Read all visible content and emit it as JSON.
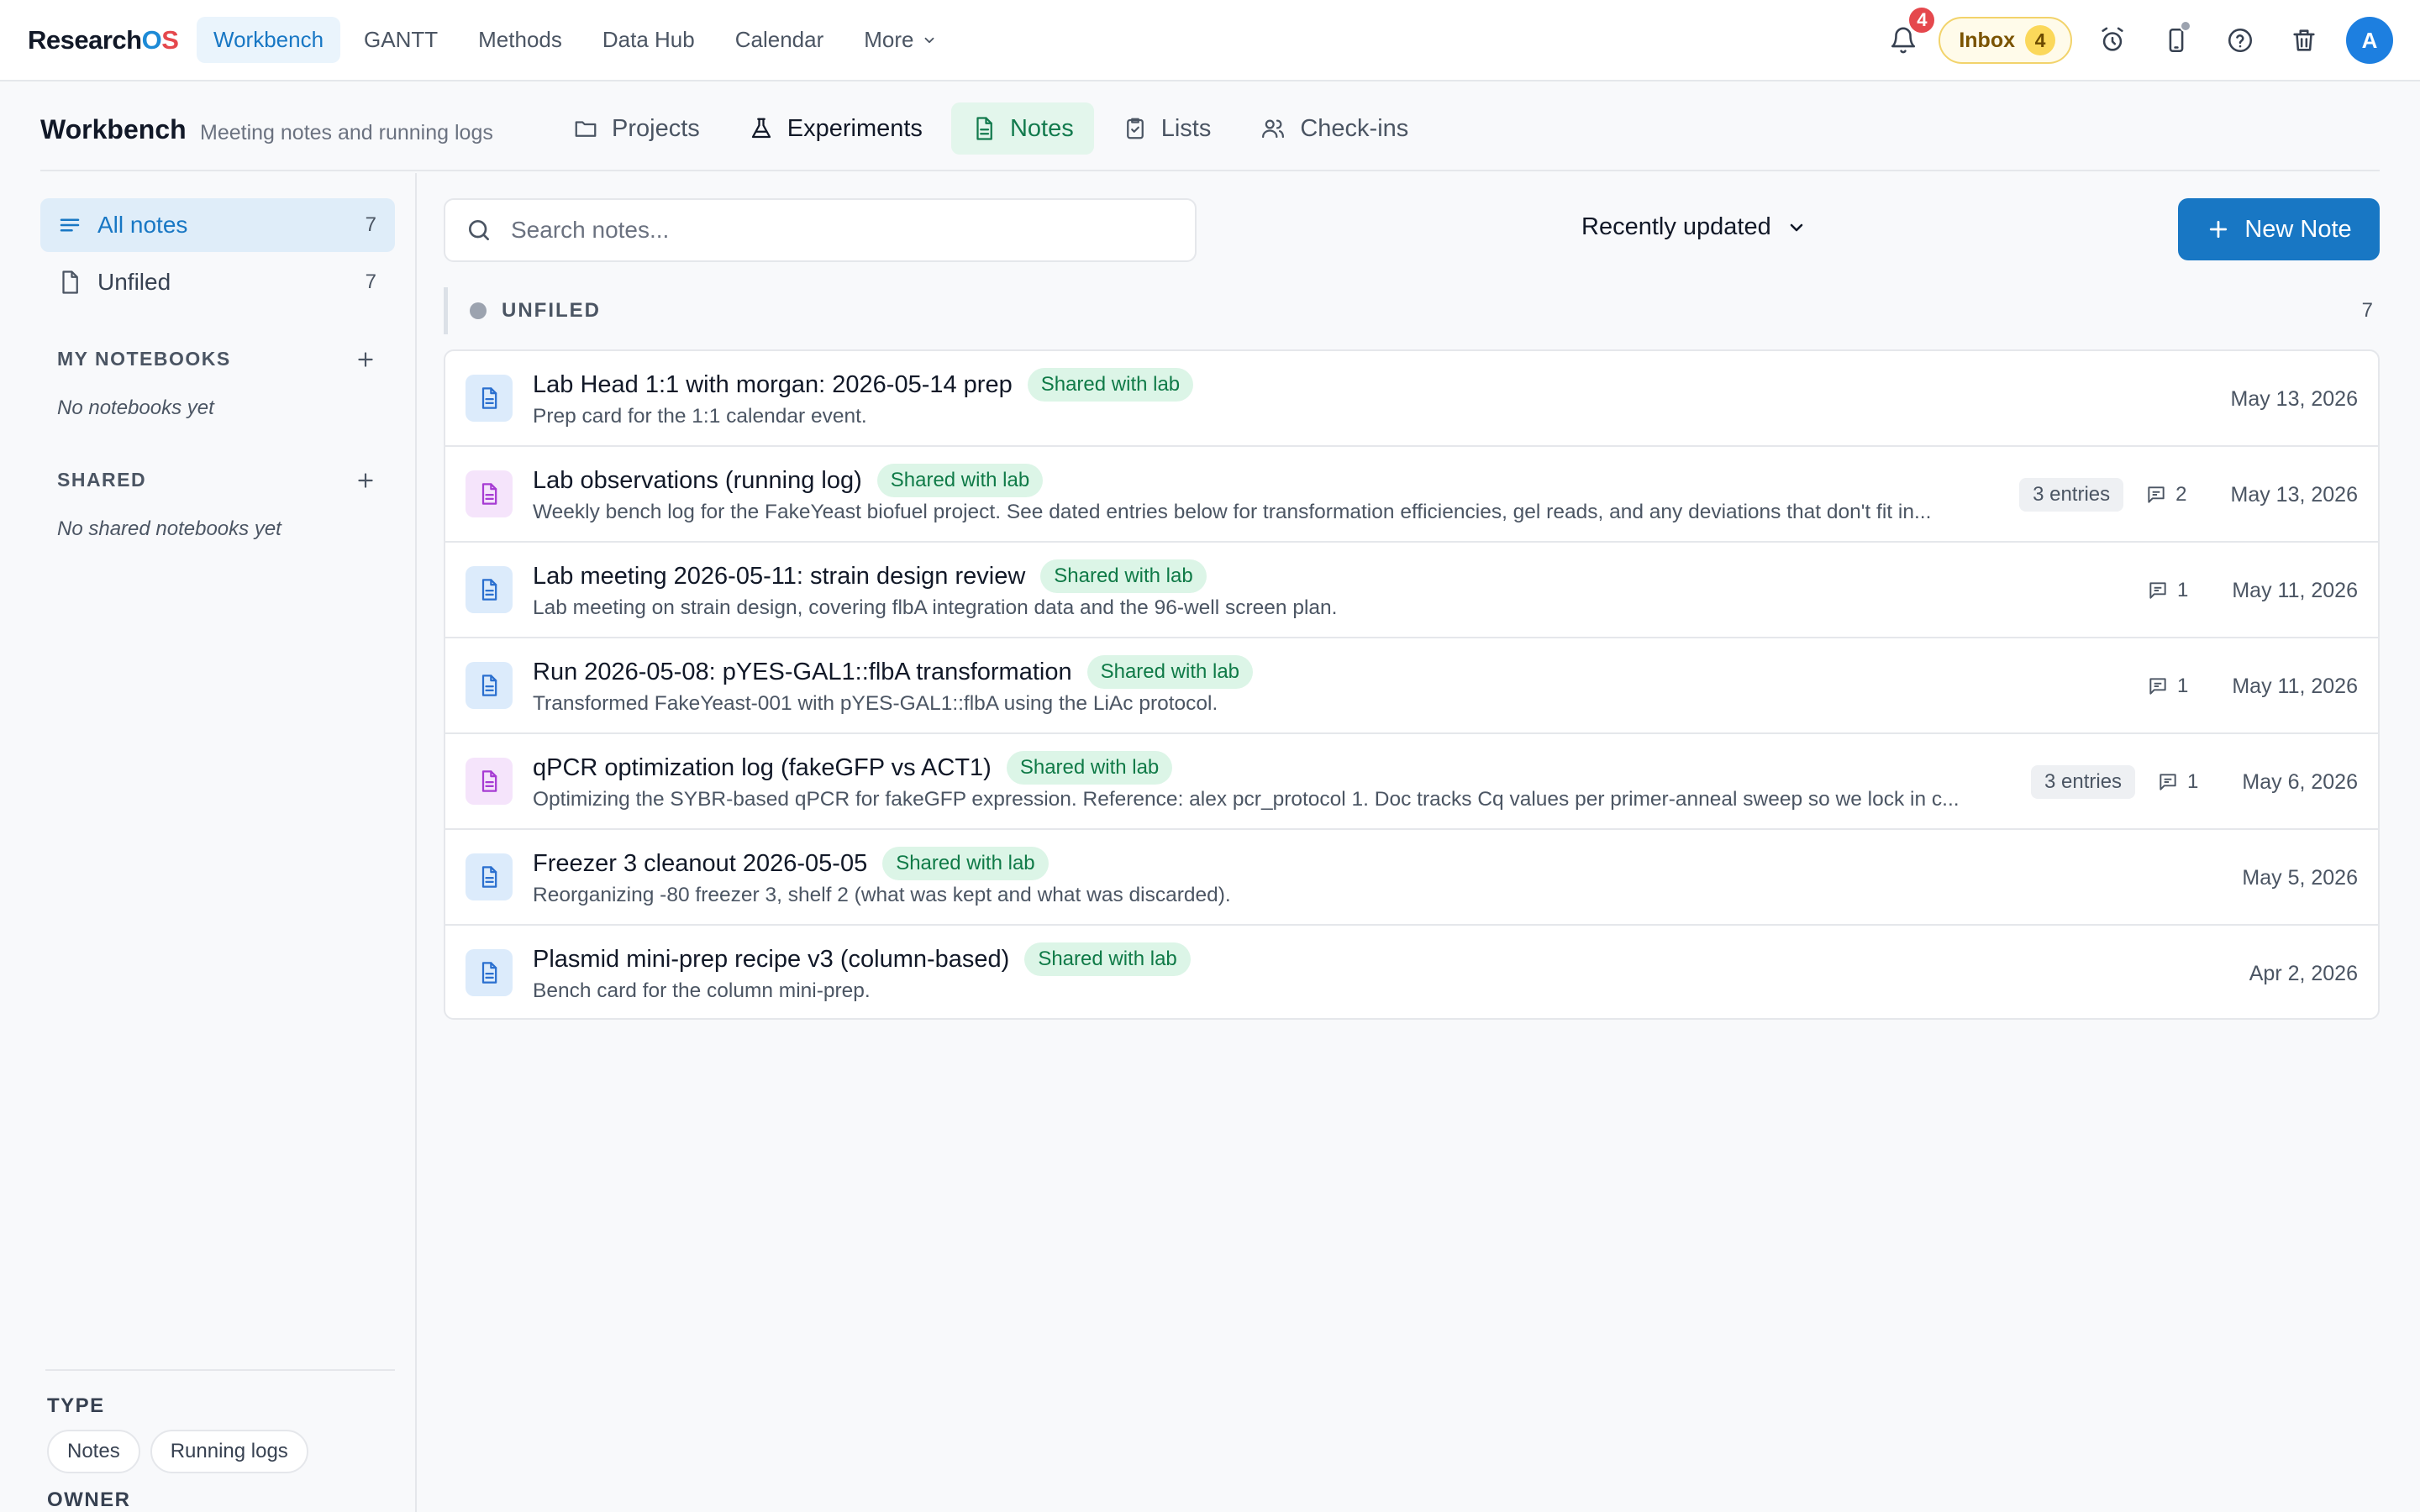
{
  "app": {
    "logo_main": "Research",
    "logo_o": "O",
    "logo_s": "S"
  },
  "nav": {
    "items": [
      {
        "label": "Workbench",
        "active": true
      },
      {
        "label": "GANTT"
      },
      {
        "label": "Methods"
      },
      {
        "label": "Data Hub"
      },
      {
        "label": "Calendar"
      }
    ],
    "more_label": "More"
  },
  "topbar": {
    "notifications_count": "4",
    "inbox_label": "Inbox",
    "inbox_count": "4",
    "avatar_initial": "A"
  },
  "header": {
    "title": "Workbench",
    "subtitle": "Meeting notes and running logs",
    "tabs": [
      {
        "label": "Projects",
        "icon": "folder-icon"
      },
      {
        "label": "Experiments",
        "icon": "flask-icon"
      },
      {
        "label": "Notes",
        "icon": "document-icon",
        "active": true
      },
      {
        "label": "Lists",
        "icon": "clipboard-check-icon"
      },
      {
        "label": "Check-ins",
        "icon": "users-icon"
      }
    ]
  },
  "sidebar": {
    "all_notes": {
      "label": "All notes",
      "count": "7"
    },
    "unfiled": {
      "label": "Unfiled",
      "count": "7"
    },
    "my_notebooks": {
      "label": "MY NOTEBOOKS",
      "empty": "No notebooks yet"
    },
    "shared": {
      "label": "SHARED",
      "empty": "No shared notebooks yet"
    },
    "filters": {
      "type_label": "TYPE",
      "type_options": [
        "Notes",
        "Running logs"
      ],
      "owner_label": "OWNER"
    }
  },
  "main": {
    "search_placeholder": "Search notes...",
    "sort_label": "Recently updated",
    "new_note_label": "New Note",
    "group": {
      "label": "UNFILED",
      "count": "7"
    },
    "notes": [
      {
        "title": "Lab Head 1:1 with morgan: 2026-05-14 prep",
        "badge": "Shared with lab",
        "description": "Prep card for the 1:1 calendar event.",
        "date": "May 13, 2026",
        "kind": "note",
        "entries": "",
        "comments": ""
      },
      {
        "title": "Lab observations (running log)",
        "badge": "Shared with lab",
        "description": "Weekly bench log for the FakeYeast biofuel project. See dated entries below for transformation efficiencies, gel reads, and any deviations that don't fit in...",
        "date": "May 13, 2026",
        "kind": "log",
        "entries": "3 entries",
        "comments": "2"
      },
      {
        "title": "Lab meeting 2026-05-11: strain design review",
        "badge": "Shared with lab",
        "description": "Lab meeting on strain design, covering flbA integration data and the 96-well screen plan.",
        "date": "May 11, 2026",
        "kind": "note",
        "entries": "",
        "comments": "1"
      },
      {
        "title": "Run 2026-05-08: pYES-GAL1::flbA transformation",
        "badge": "Shared with lab",
        "description": "Transformed FakeYeast-001 with pYES-GAL1::flbA using the LiAc protocol.",
        "date": "May 11, 2026",
        "kind": "note",
        "entries": "",
        "comments": "1"
      },
      {
        "title": "qPCR optimization log (fakeGFP vs ACT1)",
        "badge": "Shared with lab",
        "description": "Optimizing the SYBR-based qPCR for fakeGFP expression. Reference: alex pcr_protocol 1. Doc tracks Cq values per primer-anneal sweep so we lock in c...",
        "date": "May 6, 2026",
        "kind": "log",
        "entries": "3 entries",
        "comments": "1"
      },
      {
        "title": "Freezer 3 cleanout 2026-05-05",
        "badge": "Shared with lab",
        "description": "Reorganizing -80 freezer 3, shelf 2 (what was kept and what was discarded).",
        "date": "May 5, 2026",
        "kind": "note",
        "entries": "",
        "comments": ""
      },
      {
        "title": "Plasmid mini-prep recipe v3 (column-based)",
        "badge": "Shared with lab",
        "description": "Bench card for the column mini-prep.",
        "date": "Apr 2, 2026",
        "kind": "note",
        "entries": "",
        "comments": ""
      }
    ]
  },
  "colors": {
    "accent": "#1877c4",
    "notes_tab": "#127a4d",
    "shared_badge_bg": "#dcf5e7",
    "note_icon": "#2a6fcf",
    "log_icon": "#a63bd3",
    "alert": "#e5484d",
    "inbox_bg": "#fffbea"
  }
}
